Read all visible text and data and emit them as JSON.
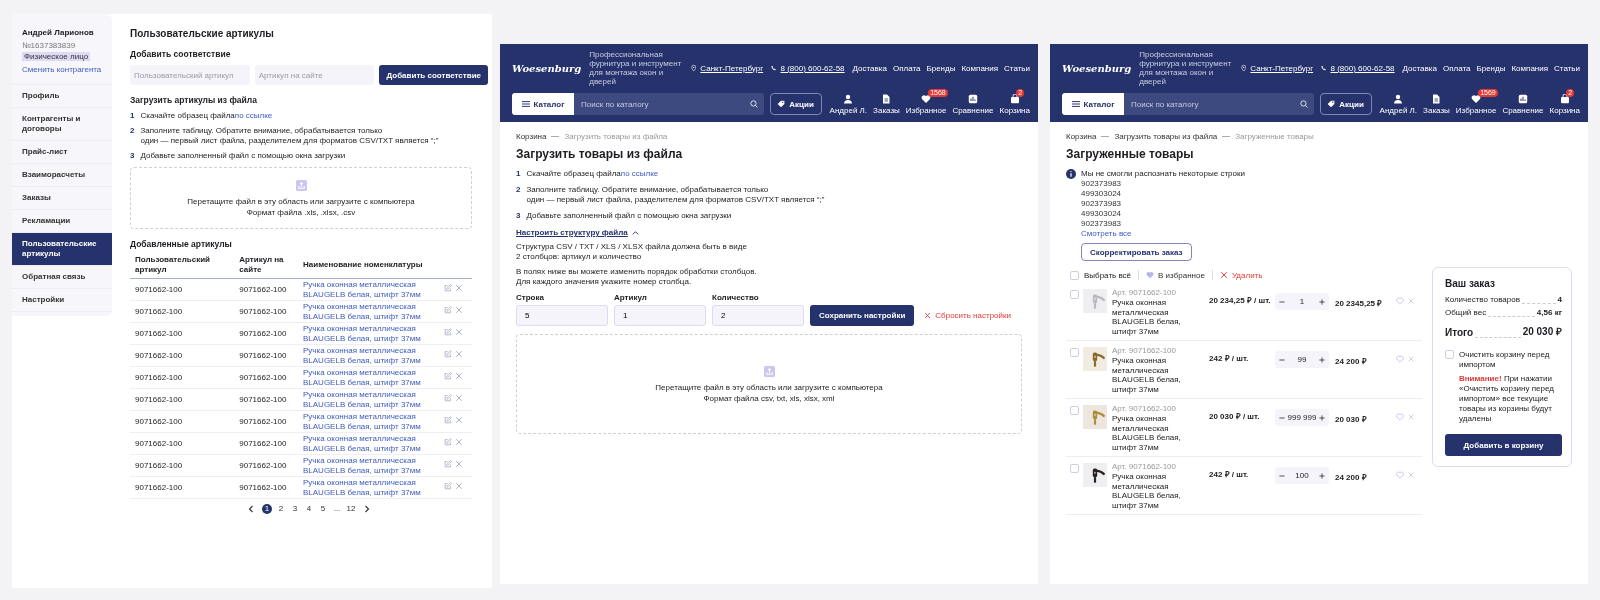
{
  "account_page": {
    "sidebar": {
      "user_name": "Андрей Ларионов",
      "account_number": "№1637383839",
      "account_type": "Физическое лицо",
      "switch_link": "Сменить контрагента",
      "items": [
        {
          "label": "Профиль",
          "selected": false
        },
        {
          "label": "Контрагенты и договоры",
          "selected": false
        },
        {
          "label": "Прайс-лист",
          "selected": false
        },
        {
          "label": "Взаиморасчеты",
          "selected": false
        },
        {
          "label": "Заказы",
          "selected": false
        },
        {
          "label": "Рекламации",
          "selected": false
        },
        {
          "label": "Пользовательские артикулы",
          "selected": true
        },
        {
          "label": "Обратная связь",
          "selected": false
        },
        {
          "label": "Настройки",
          "selected": false
        }
      ]
    },
    "title": "Пользовательские артикулы",
    "add_mapping": {
      "heading": "Добавить соответствие",
      "fields": [
        {
          "placeholder": "Пользовательский артикул"
        },
        {
          "placeholder": "Артикул на сайте"
        }
      ],
      "button": "Добавить соответствие"
    },
    "upload": {
      "heading": "Загрузить артикулы из файла",
      "steps": [
        {
          "number": "1",
          "text": "Скачайте образец файла",
          "link": "по ссылке"
        },
        {
          "number": "2",
          "text": "Заполните таблицу. Обратите внимание, обрабатывается только\nодин — первый лист файла, разделителем для форматов CSV/TXT является “;”"
        },
        {
          "number": "3",
          "text": "Добавьте заполненный файл с помощью окна загрузки"
        }
      ],
      "dropzone": {
        "text": "Перетащите файл в эту область или загрузите с компьютера",
        "formats": "Формат файла .xls, .xlsx, .csv"
      }
    },
    "added": {
      "heading": "Добавленные артикулы",
      "columns": [
        "Пользовательский артикул",
        "Артикул на сайте",
        "Наименование номенклатуры"
      ],
      "rows": [
        {
          "user_article": "9071662-100",
          "site_article": "9071662-100",
          "name": "Ручка оконная металлическая BLAUGELB белая, штифт 37мм"
        },
        {
          "user_article": "9071662-100",
          "site_article": "9071662-100",
          "name": "Ручка оконная металлическая BLAUGELB белая, штифт 37мм"
        },
        {
          "user_article": "9071662-100",
          "site_article": "9071662-100",
          "name": "Ручка оконная металлическая BLAUGELB белая, штифт 37мм"
        },
        {
          "user_article": "9071662-100",
          "site_article": "9071662-100",
          "name": "Ручка оконная металлическая BLAUGELB белая, штифт 37мм"
        },
        {
          "user_article": "9071662-100",
          "site_article": "9071662-100",
          "name": "Ручка оконная металлическая BLAUGELB белая, штифт 37мм"
        },
        {
          "user_article": "9071662-100",
          "site_article": "9071662-100",
          "name": "Ручка оконная металлическая BLAUGELB белая, штифт 37мм"
        },
        {
          "user_article": "9071662-100",
          "site_article": "9071662-100",
          "name": "Ручка оконная металлическая BLAUGELB белая, штифт 37мм"
        },
        {
          "user_article": "9071662-100",
          "site_article": "9071662-100",
          "name": "Ручка оконная металлическая BLAUGELB белая, штифт 37мм"
        },
        {
          "user_article": "9071662-100",
          "site_article": "9071662-100",
          "name": "Ручка оконная металлическая BLAUGELB белая, штифт 37мм"
        },
        {
          "user_article": "9071662-100",
          "site_article": "9071662-100",
          "name": "Ручка оконная металлическая BLAUGELB белая, штифт 37мм"
        }
      ],
      "pagination": [
        {
          "label": "1",
          "selected": true
        },
        {
          "label": "2",
          "selected": false
        },
        {
          "label": "3",
          "selected": false
        },
        {
          "label": "4",
          "selected": false
        },
        {
          "label": "5",
          "selected": false
        },
        {
          "label": "...",
          "selected": false
        },
        {
          "label": "12",
          "selected": false
        }
      ]
    }
  },
  "shop_pages": [
    {
      "kind": "import",
      "header": {
        "logo": "Woesenburg",
        "tagline": "Профессиональная фурнитура и инструмент\nдля монтажа окон и дверей",
        "city": "Санкт-Петербург",
        "phone": "8 (800) 600-62-58",
        "nav": [
          "Доставка",
          "Оплата",
          "Бренды",
          "Компания",
          "Статьи"
        ],
        "catalog_button": "Каталог",
        "search_placeholder": "Поиск по каталогу",
        "promo_button": "Акции",
        "icons": [
          {
            "kind": "user",
            "label": "Андрей Л."
          },
          {
            "kind": "orders",
            "label": "Заказы"
          },
          {
            "kind": "favorites",
            "label": "Избранное",
            "badge": "1568"
          },
          {
            "kind": "compare",
            "label": "Сравнение"
          },
          {
            "kind": "cart",
            "label": "Корзина",
            "badge": "2"
          }
        ]
      },
      "breadcrumbs": [
        {
          "label": "Корзина",
          "current": false
        },
        {
          "label": "Загрузить товары из файла",
          "current": true
        }
      ],
      "title": "Загрузить товары из файла",
      "steps": [
        {
          "number": "1",
          "text": "Скачайте образец файла",
          "link": "по ссылке"
        },
        {
          "number": "2",
          "text": "Заполните таблицу. Обратите внимание, обрабатывается только\nодин — первый лист файла, разделителем для форматов CSV/TXT является “;”"
        },
        {
          "number": "3",
          "text": "Добавьте заполненный файл с помощью окна загрузки"
        }
      ],
      "settings_toggle": {
        "label": "Настроить структуру файла",
        "expanded": true
      },
      "structure_note": "Структура CSV / TXT / XLS / XLSX файла должна быть в виде\n2 столбцов: артикул и количество",
      "fields_note": "В полях ниже вы можете изменить порядок обработки столбцов.\nДля каждого значения укажите номер столбца.",
      "fields": [
        {
          "label": "Строка",
          "value": "5"
        },
        {
          "label": "Артикул",
          "value": "1"
        },
        {
          "label": "Количество",
          "value": "2"
        }
      ],
      "save_button": "Сохранить настройки",
      "reset_link": "Сбросить настройки",
      "dropzone": {
        "text": "Перетащите файл в эту область или загрузите с компьютера",
        "formats": "Формат файла csv, txt, xls, xlsx, xml"
      }
    },
    {
      "kind": "result",
      "header": {
        "logo": "Woesenburg",
        "tagline": "Профессиональная фурнитура и инструмент\nдля монтажа окон и дверей",
        "city": "Санкт-Петербург",
        "phone": "8 (800) 600-62-58",
        "nav": [
          "Доставка",
          "Оплата",
          "Бренды",
          "Компания",
          "Статьи"
        ],
        "catalog_button": "Каталог",
        "search_placeholder": "Поиск по каталогу",
        "promo_button": "Акции",
        "icons": [
          {
            "kind": "user",
            "label": "Андрей Л."
          },
          {
            "kind": "orders",
            "label": "Заказы"
          },
          {
            "kind": "favorites",
            "label": "Избранное",
            "badge": "1569"
          },
          {
            "kind": "compare",
            "label": "Сравнение"
          },
          {
            "kind": "cart",
            "label": "Корзина",
            "badge": "2"
          }
        ]
      },
      "breadcrumbs": [
        {
          "label": "Корзина",
          "current": false
        },
        {
          "label": "Загрузить товары из файла",
          "current": false
        },
        {
          "label": "Загруженные товары",
          "current": true
        }
      ],
      "title": "Загруженные товары",
      "notice": {
        "text": "Мы не смогли распознать некоторые строки",
        "codes": [
          "902373983",
          "499303024",
          "902373983",
          "499303024",
          "902373983"
        ],
        "link": "Смотреть все"
      },
      "correct_button": "Скорректировать заказ",
      "toolbar": {
        "select_all": {
          "label": "Выбрать всё",
          "checked": false
        },
        "favorites": "В избранное",
        "delete": "Удалить"
      },
      "items": [
        {
          "article": "Арт. 9071662-100",
          "name": "Ручка оконная металлическая\nBLAUGELB белая, штифт 37мм",
          "price": "20 234,25 ₽ / шт.",
          "quantity": "1",
          "total": "20 2345,25 ₽",
          "checked": false
        },
        {
          "article": "Арт. 9071662-100",
          "name": "Ручка оконная металлическая\nBLAUGELB белая, штифт 37мм",
          "price": "242 ₽ / шт.",
          "quantity": "99",
          "total": "24 200 ₽",
          "checked": false
        },
        {
          "article": "Арт. 9071662-100",
          "name": "Ручка оконная металлическая\nBLAUGELB белая, штифт 37мм",
          "price": "20 030 ₽ / шт.",
          "quantity": "999 999",
          "total": "20 030 ₽",
          "checked": false
        },
        {
          "article": "Арт. 9071662-100",
          "name": "Ручка оконная металлическая\nBLAUGELB белая, штифт 37мм",
          "price": "242 ₽ / шт.",
          "quantity": "100",
          "total": "24 200 ₽",
          "checked": false
        }
      ],
      "summary": {
        "title": "Ваш заказ",
        "rows": [
          {
            "label": "Количество товаров",
            "value": "4"
          },
          {
            "label": "Общий вес",
            "value": "4,56 кг"
          }
        ],
        "total_label": "Итого",
        "total_value": "20 030 ₽",
        "clear_cart": {
          "label": "Очистить корзину перед импортом",
          "checked": false
        },
        "warning_label": "Внимание!",
        "warning_text": "При нажатии «Очистить корзину перед импортом» все текущие товары из корзины будут удалены",
        "button": "Добавить в корзину"
      }
    }
  ]
}
